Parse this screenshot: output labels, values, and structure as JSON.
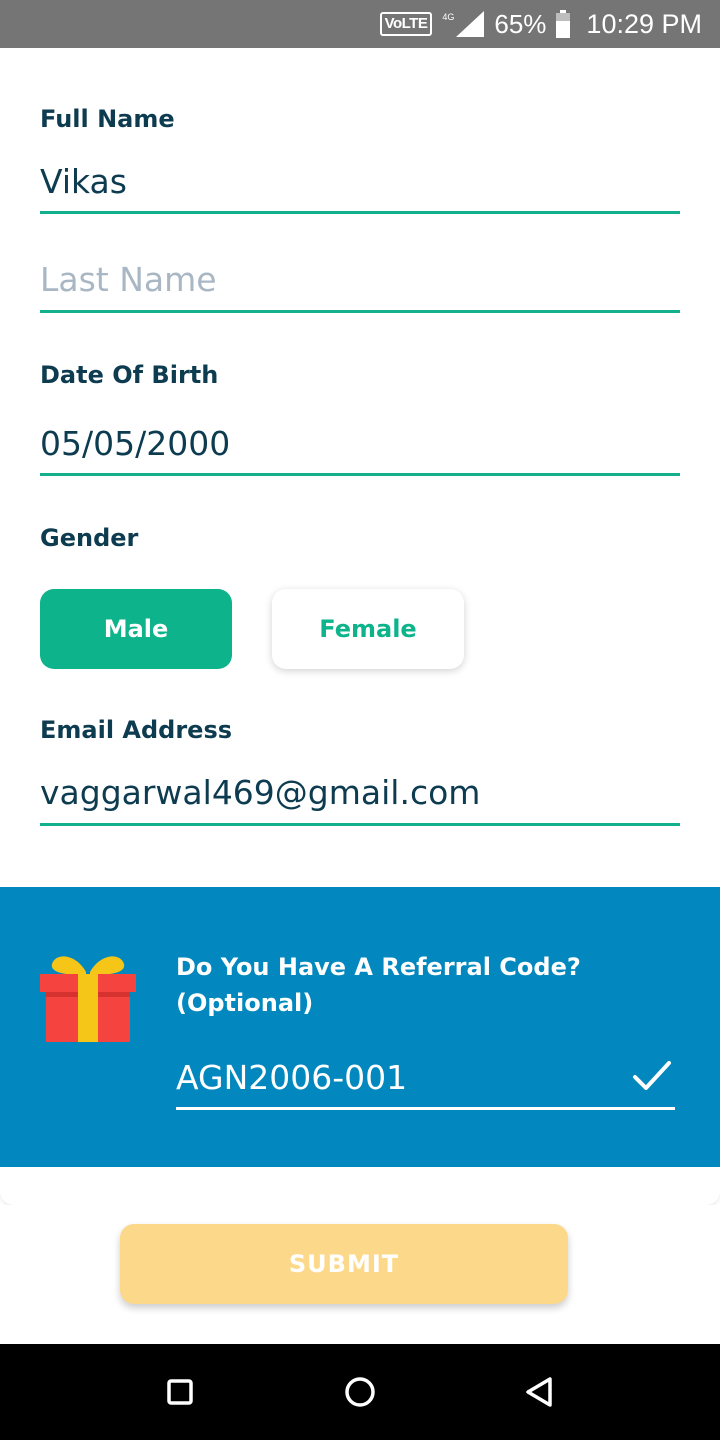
{
  "status_bar": {
    "volte": "VoLTE",
    "network": "4G",
    "battery_percent": "65%",
    "time": "10:29 PM",
    "icons": [
      "signal-icon",
      "battery-icon"
    ]
  },
  "form": {
    "full_name": {
      "label": "Full Name",
      "value": "Vikas"
    },
    "last_name": {
      "placeholder": "Last Name",
      "value": ""
    },
    "dob": {
      "label": "Date Of Birth",
      "value": "05/05/2000"
    },
    "gender": {
      "label": "Gender",
      "options": [
        "Male",
        "Female"
      ],
      "selected": "Male"
    },
    "email": {
      "label": "Email Address",
      "value": "vaggarwal469@gmail.com"
    }
  },
  "referral": {
    "question": "Do You Have A Referral Code? (Optional)",
    "code": "AGN2006-001",
    "icon": "gift-icon",
    "status_icon": "check-icon"
  },
  "submit": {
    "label": "SUBMIT"
  },
  "nav_bar": {
    "icons": [
      "recent-apps-icon",
      "home-icon",
      "back-icon"
    ]
  },
  "colors": {
    "accent_green": "#0db38b",
    "referral_blue": "#0288be",
    "submit_disabled": "#fcd98a",
    "text_dark": "#0d3b4f",
    "placeholder": "#a9b7c4"
  }
}
